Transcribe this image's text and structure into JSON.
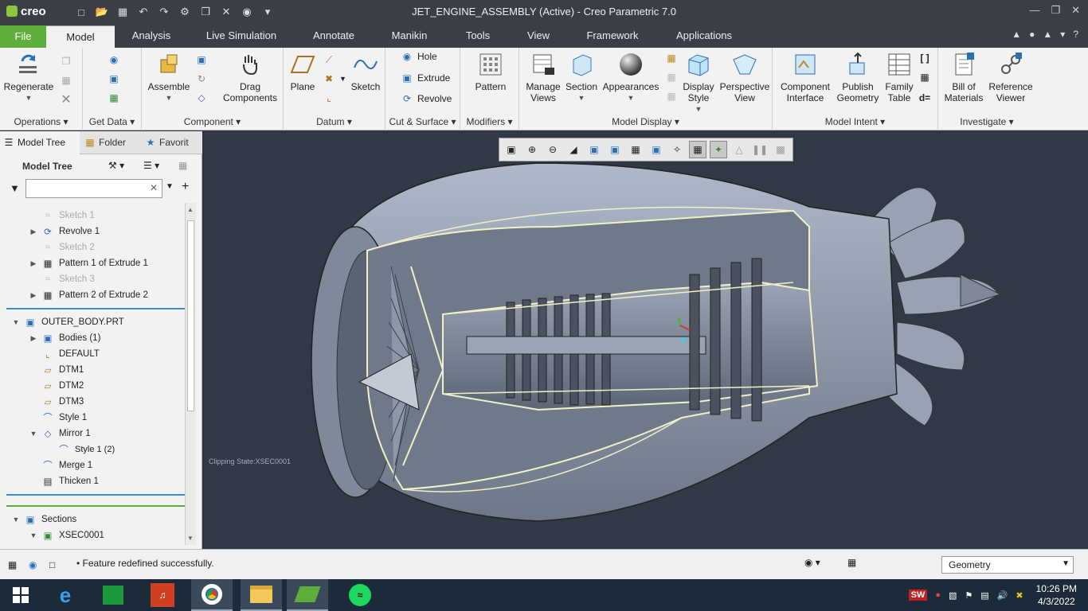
{
  "app": {
    "name": "creo",
    "title": "JET_ENGINE_ASSEMBLY (Active) - Creo Parametric 7.0"
  },
  "ribbon_tabs": [
    {
      "label": "File"
    },
    {
      "label": "Model"
    },
    {
      "label": "Analysis"
    },
    {
      "label": "Live Simulation"
    },
    {
      "label": "Annotate"
    },
    {
      "label": "Manikin"
    },
    {
      "label": "Tools"
    },
    {
      "label": "View"
    },
    {
      "label": "Framework"
    },
    {
      "label": "Applications"
    }
  ],
  "ribbon": {
    "operations": {
      "label": "Operations",
      "regenerate": "Regenerate"
    },
    "get_data": {
      "label": "Get Data"
    },
    "component": {
      "label": "Component",
      "assemble": "Assemble",
      "drag": "Drag Components"
    },
    "datum": {
      "label": "Datum",
      "plane": "Plane",
      "sketch": "Sketch"
    },
    "cut_surface": {
      "label": "Cut & Surface",
      "hole": "Hole",
      "extrude": "Extrude",
      "revolve": "Revolve"
    },
    "modifiers": {
      "label": "Modifiers",
      "pattern": "Pattern"
    },
    "model_display": {
      "label": "Model Display",
      "manage_views": "Manage Views",
      "section": "Section",
      "appearances": "Appearances",
      "display_style": "Display Style",
      "perspective": "Perspective View"
    },
    "model_intent": {
      "label": "Model Intent",
      "component_interface": "Component Interface",
      "publish_geometry": "Publish Geometry",
      "family_table": "Family Table"
    },
    "investigate": {
      "label": "Investigate",
      "bom": "Bill of Materials",
      "reference_viewer": "Reference Viewer"
    }
  },
  "panel": {
    "tabs": [
      {
        "label": "Model Tree"
      },
      {
        "label": "Folder"
      },
      {
        "label": "Favorit"
      }
    ],
    "tree_title": "Model Tree",
    "tree_items": [
      {
        "label": "Sketch 1",
        "dim": true
      },
      {
        "label": "Revolve 1",
        "dim": false
      },
      {
        "label": "Sketch 2",
        "dim": true
      },
      {
        "label": "Pattern 1 of Extrude 1",
        "dim": false
      },
      {
        "label": "Sketch 3",
        "dim": true
      },
      {
        "label": "Pattern 2 of Extrude 2",
        "dim": false
      },
      {
        "label": "OUTER_BODY.PRT",
        "dim": false
      },
      {
        "label": "Bodies (1)",
        "dim": false
      },
      {
        "label": "DEFAULT",
        "dim": false
      },
      {
        "label": "DTM1",
        "dim": false
      },
      {
        "label": "DTM2",
        "dim": false
      },
      {
        "label": "DTM3",
        "dim": false
      },
      {
        "label": "Style 1",
        "dim": false
      },
      {
        "label": "Mirror 1",
        "dim": false
      },
      {
        "label": "Style 1 (2)",
        "dim": false
      },
      {
        "label": "Merge 1",
        "dim": false
      },
      {
        "label": "Thicken 1",
        "dim": false
      },
      {
        "label": "Sections",
        "dim": false
      },
      {
        "label": "XSEC0001",
        "dim": false
      }
    ]
  },
  "viewport": {
    "clipping_state": "Clipping State:XSEC0001"
  },
  "status": {
    "message": "Feature redefined successfully.",
    "selection_filter": "Geometry"
  },
  "taskbar": {
    "time": "10:26 PM",
    "date": "4/3/2022"
  },
  "colors": {
    "file_tab": "#5fae3b",
    "titlebar": "#3b3f45",
    "viewport_bg": "#313846",
    "model_surface": "#8d97a8",
    "section_edge": "#f2f0c8"
  }
}
